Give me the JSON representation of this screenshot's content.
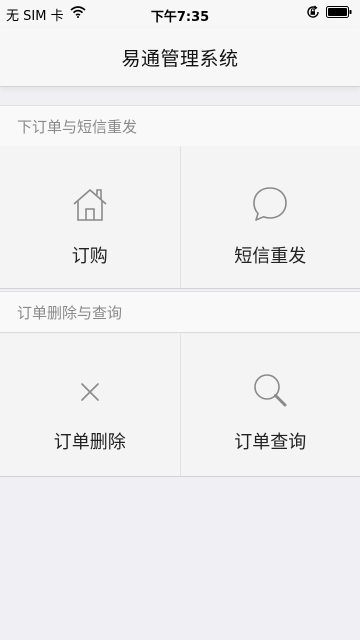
{
  "status_bar": {
    "carrier": "无 SIM 卡",
    "time": "下午7:35",
    "icons": [
      "wifi-icon",
      "orientation-lock-icon",
      "battery-icon"
    ]
  },
  "nav": {
    "title": "易通管理系统"
  },
  "sections": [
    {
      "header": "下订单与短信重发",
      "items": [
        {
          "label": "订购",
          "icon": "home-icon"
        },
        {
          "label": "短信重发",
          "icon": "chat-bubble-icon"
        }
      ]
    },
    {
      "header": "订单删除与查询",
      "items": [
        {
          "label": "订单删除",
          "icon": "close-icon"
        },
        {
          "label": "订单查询",
          "icon": "search-icon"
        }
      ]
    }
  ],
  "colors": {
    "background": "#efeff4",
    "cell_background": "#f4f4f4",
    "icon_stroke": "#8a8a8a",
    "section_header_text": "#8a8a8a"
  }
}
